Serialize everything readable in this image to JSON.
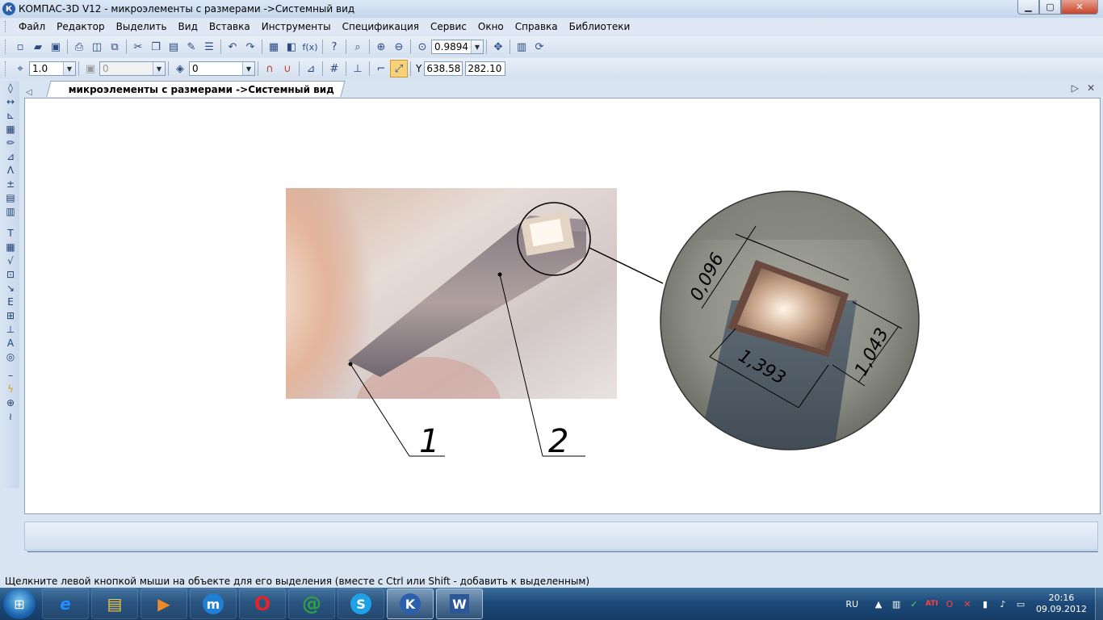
{
  "window": {
    "title": "КОМПАС-3D V12 - микроэлементы с размерами ->Системный вид",
    "logo": "К",
    "buttons": {
      "minimize": "▁",
      "maximize": "▢",
      "close": "✕"
    }
  },
  "menu": [
    "Файл",
    "Редактор",
    "Выделить",
    "Вид",
    "Вставка",
    "Инструменты",
    "Спецификация",
    "Сервис",
    "Окно",
    "Справка",
    "Библиотеки"
  ],
  "toolbar1": {
    "zoom_value": "0.9894",
    "fx_label": "f(x)",
    "icons": [
      "new-file-icon",
      "open-file-icon",
      "save-icon",
      "print-icon",
      "preview-icon",
      "copy-format-icon",
      "cut-icon",
      "copy-icon",
      "paste-icon",
      "brush-icon",
      "properties-icon",
      "undo-icon",
      "redo-icon",
      "manager-icon",
      "library-icon",
      "variables-icon",
      "help-pointer-icon",
      "zoom-window-icon",
      "zoom-in-icon",
      "zoom-out-icon",
      "zoom-scale-icon",
      "pan-icon",
      "refresh-icon",
      "rebuild-icon"
    ]
  },
  "toolbar2": {
    "step_value": "1.0",
    "style_value": "0",
    "layer_value": "0",
    "coord_x": "638.58",
    "coord_y": "282.10",
    "y_label": "Y"
  },
  "document": {
    "tab_label": "микроэлементы с размерами ->Системный вид"
  },
  "drawing": {
    "callouts": [
      "1",
      "2"
    ],
    "dimensions": [
      "0,096",
      "1,393",
      "1,043"
    ]
  },
  "status": {
    "hint": "Щелкните левой кнопкой мыши на объекте для его выделения (вместе с Ctrl или Shift - добавить к выделенным)"
  },
  "taskbar": {
    "apps": [
      {
        "name": "ie",
        "glyph": "e",
        "color": "#1e90ff"
      },
      {
        "name": "explorer",
        "glyph": "▤",
        "color": "#f1c84a"
      },
      {
        "name": "media-player",
        "glyph": "▶",
        "color": "#f08a24"
      },
      {
        "name": "maxthon",
        "glyph": "m",
        "color": "#ffffff"
      },
      {
        "name": "opera",
        "glyph": "O",
        "color": "#e0262b"
      },
      {
        "name": "mail-agent",
        "glyph": "@",
        "color": "#2ea043"
      },
      {
        "name": "skype",
        "glyph": "S",
        "color": "#1fa1e8"
      },
      {
        "name": "kompas",
        "glyph": "K",
        "color": "#ffffff"
      },
      {
        "name": "word",
        "glyph": "W",
        "color": "#2b579a"
      }
    ],
    "language": "RU",
    "time": "20:16",
    "date": "09.09.2012"
  }
}
